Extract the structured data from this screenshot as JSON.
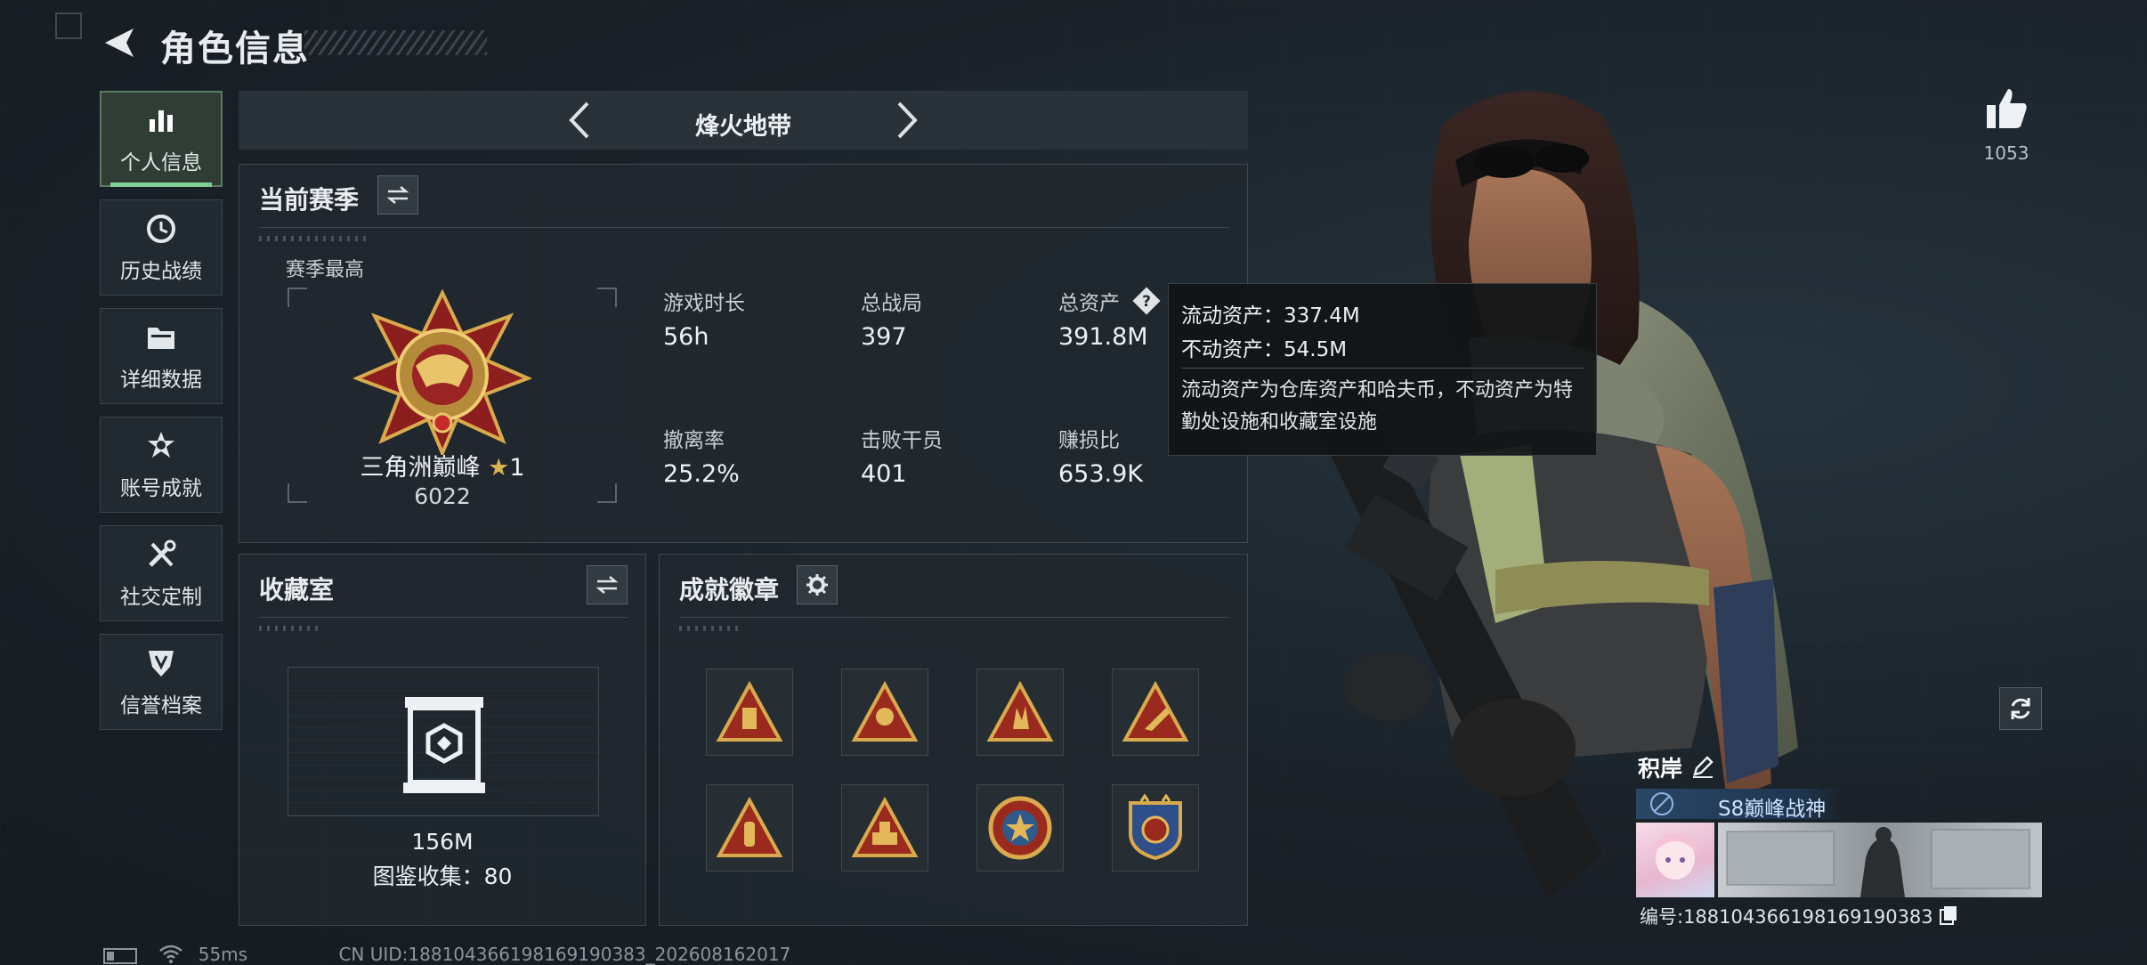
{
  "header": {
    "title": "角色信息"
  },
  "nav": {
    "items": [
      {
        "label": "个人信息",
        "icon": "bar-chart-icon",
        "active": true
      },
      {
        "label": "历史战绩",
        "icon": "clock-history-icon",
        "active": false
      },
      {
        "label": "详细数据",
        "icon": "folder-icon",
        "active": false
      },
      {
        "label": "账号成就",
        "icon": "achievement-star-icon",
        "active": false
      },
      {
        "label": "社交定制",
        "icon": "wrench-screwdriver-icon",
        "active": false
      },
      {
        "label": "信誉档案",
        "icon": "shield-icon",
        "active": false
      }
    ]
  },
  "mode": {
    "name": "烽火地带"
  },
  "season": {
    "title": "当前赛季",
    "best_label": "赛季最高",
    "rank_name": "三角洲巅峰",
    "rank_stars": "1",
    "rank_score": "6022",
    "stats": [
      {
        "label": "游戏时长",
        "value": "56h"
      },
      {
        "label": "总战局",
        "value": "397"
      },
      {
        "label": "总资产",
        "value": "391.8M"
      },
      {
        "label": "撤离率",
        "value": "25.2%"
      },
      {
        "label": "击败干员",
        "value": "401"
      },
      {
        "label": "赚损比",
        "value": "653.9K"
      }
    ]
  },
  "tooltip": {
    "liquid": "流动资产：337.4M",
    "fixed": "不动资产：54.5M",
    "desc": "流动资产为仓库资产和哈夫币，不动资产为特勤处设施和收藏室设施"
  },
  "collection": {
    "title": "收藏室",
    "value": "156M",
    "catalog": "图鉴收集：80"
  },
  "badges": {
    "title": "成就徽章",
    "count": 8
  },
  "player": {
    "likes": "1053",
    "name": "积岸",
    "title_tag": "S8巅峰战神",
    "id_line": "编号:1881043661981691903​83"
  },
  "status": {
    "ping": "55ms",
    "uid": "CN UID:1881043661981691903​83_202608162017"
  },
  "colors": {
    "accent_green": "#7ecf94",
    "gold": "#c9a24a",
    "panel": "#212830"
  }
}
